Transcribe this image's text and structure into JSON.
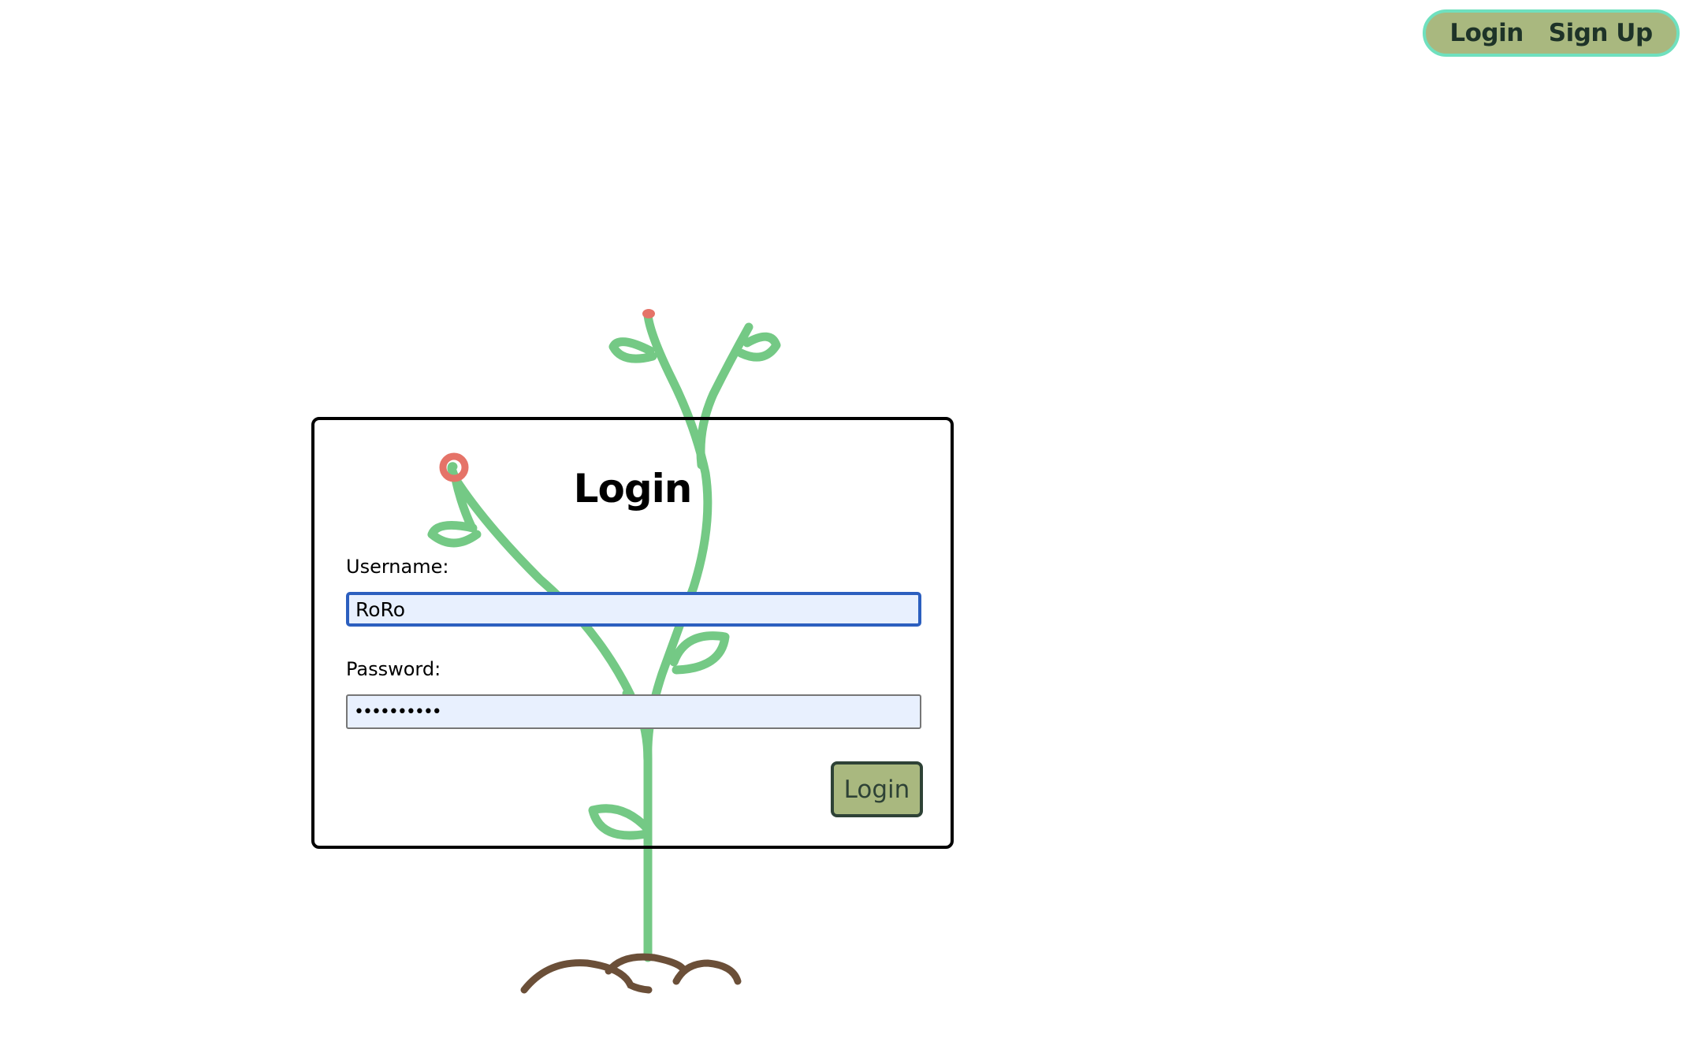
{
  "nav": {
    "login_label": "Login",
    "signup_label": "Sign Up"
  },
  "login_form": {
    "title": "Login",
    "username_label": "Username:",
    "username_value": "RoRo",
    "password_label": "Password:",
    "password_value": "••••••••••",
    "submit_label": "Login"
  },
  "colors": {
    "nav_background": "#a9b87f",
    "nav_border": "#6fe0be",
    "stem_green": "#74c985",
    "bud_red": "#e57368",
    "soil_brown": "#6b4f38",
    "input_fill": "#e8f0fe",
    "focus_border": "#2c5fbf"
  },
  "illustration": {
    "name": "growing-plant-illustration"
  }
}
